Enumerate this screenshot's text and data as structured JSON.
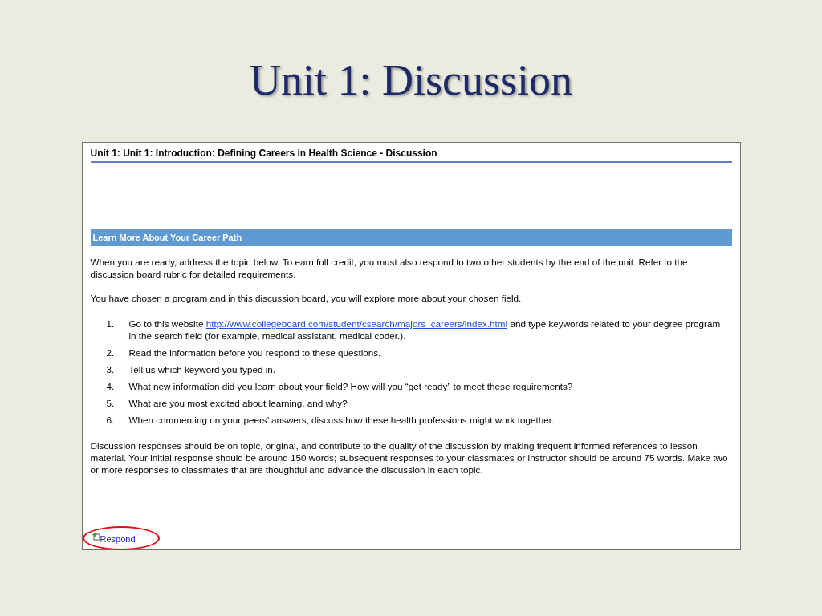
{
  "slide": {
    "title": "Unit 1: Discussion"
  },
  "page": {
    "heading": "Unit 1: Unit 1: Introduction: Defining Careers in Health Science - Discussion",
    "section_title": "Learn More About Your Career Path",
    "intro": "When you are ready, address the topic below. To earn full credit, you must also respond to two other students by the end of the unit. Refer to the discussion board rubric for detailed requirements.",
    "lead": "You have chosen a program and in this discussion board, you will explore more about your chosen field.",
    "steps": [
      {
        "number": "1.",
        "text_before": "Go to this website ",
        "link": "http://www.collegeboard.com/student/csearch/majors_careers/index.html",
        "text_after": " and type keywords related to your degree program in the search field (for example, medical assistant, medical coder.)."
      },
      {
        "number": "2.",
        "text_before": "Read the information before you respond to these questions."
      },
      {
        "number": "3.",
        "text_before": "Tell us which keyword you typed in."
      },
      {
        "number": "4.",
        "text_before": "What new information did you learn about your field? How will you “get ready” to meet these requirements?"
      },
      {
        "number": "5.",
        "text_before": "What are you most excited about learning, and why?"
      },
      {
        "number": "6.",
        "text_before": "When commenting on your peers’ answers, discuss how these health professions might work together."
      }
    ],
    "closing": "Discussion responses should be on topic, original, and contribute to the quality of the discussion by making frequent informed references to lesson material. Your initial response should be around 150 words; subsequent responses to your classmates or instructor should be around 75 words. Make two or more responses to classmates that are thoughtful and advance the discussion in each topic.",
    "respond_link": {
      "label": "Respond",
      "circled": true
    }
  }
}
